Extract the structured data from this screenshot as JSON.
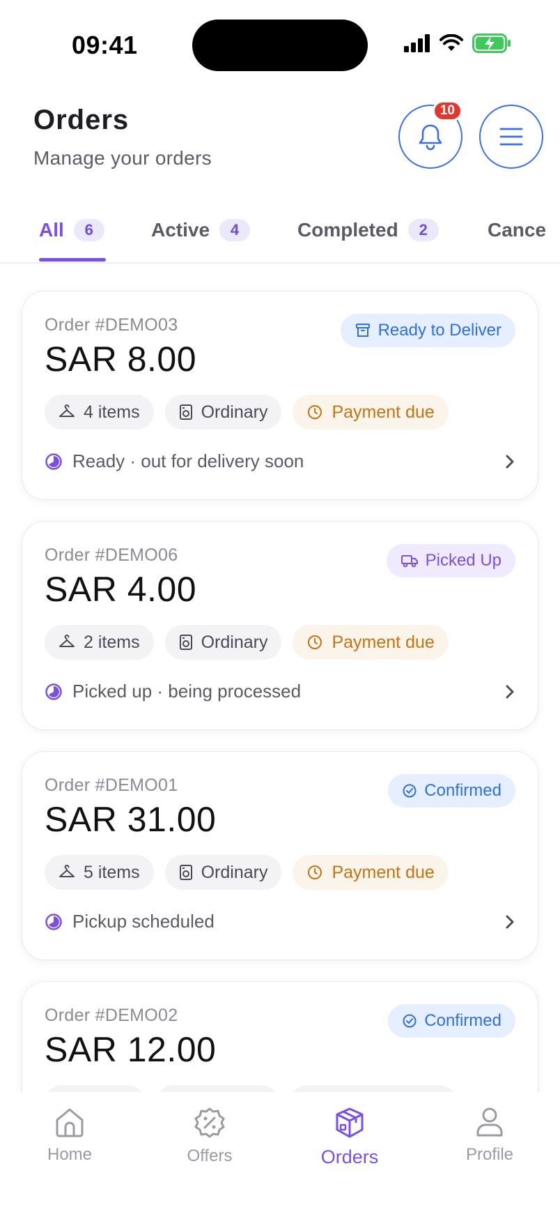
{
  "status_bar": {
    "time": "09:41"
  },
  "header": {
    "title": "Orders",
    "subtitle": "Manage your orders",
    "notification_count": "10"
  },
  "tabs": [
    {
      "label": "All",
      "count": "6",
      "active": true
    },
    {
      "label": "Active",
      "count": "4",
      "active": false
    },
    {
      "label": "Completed",
      "count": "2",
      "active": false
    },
    {
      "label": "Cance",
      "count": "",
      "active": false
    }
  ],
  "orders": [
    {
      "id": "Order #DEMO03",
      "amount": "SAR 8.00",
      "status": "Ready to Deliver",
      "status_icon": "box-icon",
      "status_color": "#2e6ee6",
      "items": "4 items",
      "type": "Ordinary",
      "payment": "Payment due",
      "progress": "Ready · out for delivery soon"
    },
    {
      "id": "Order #DEMO06",
      "amount": "SAR 4.00",
      "status": "Picked Up",
      "status_icon": "truck-icon",
      "status_color": "#7a4fe6",
      "items": "2 items",
      "type": "Ordinary",
      "payment": "Payment due",
      "progress": "Picked up · being processed"
    },
    {
      "id": "Order #DEMO01",
      "amount": "SAR 31.00",
      "status": "Confirmed",
      "status_icon": "check-circle-icon",
      "status_color": "#2e6ee6",
      "items": "5 items",
      "type": "Ordinary",
      "payment": "Payment due",
      "progress": "Pickup scheduled"
    },
    {
      "id": "Order #DEMO02",
      "amount": "SAR 12.00",
      "status": "Confirmed",
      "status_icon": "check-circle-icon",
      "status_color": "#2e6ee6"
    }
  ],
  "bottom_nav": [
    {
      "label": "Home",
      "icon": "home-icon"
    },
    {
      "label": "Offers",
      "icon": "offers-icon"
    },
    {
      "label": "Orders",
      "icon": "orders-icon",
      "active": true
    },
    {
      "label": "Profile",
      "icon": "profile-icon"
    }
  ],
  "colors": {
    "accent": "#7a4fe6",
    "primary_blue": "#3a6ee8",
    "warning": "#c47412",
    "badge_red": "#e0382f"
  }
}
